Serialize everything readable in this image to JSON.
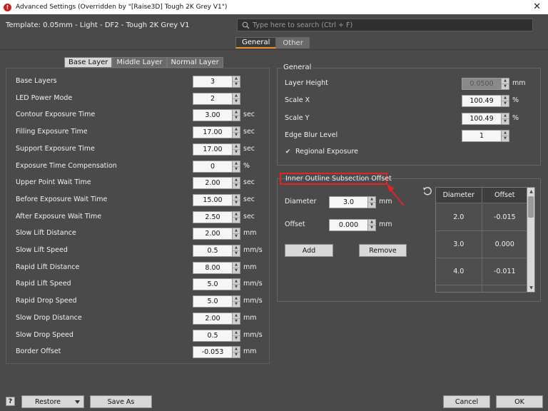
{
  "window": {
    "title": "Advanced Settings (Overridden by \"[Raise3D] Tough 2K Grey V1\")",
    "app_icon_glyph": "!",
    "close_glyph": "✕"
  },
  "template": {
    "label": "Template: 0.05mm - Light - DF2 - Tough 2K Grey V1"
  },
  "search": {
    "placeholder": "Type here to search (Ctrl + F)"
  },
  "top_tabs": [
    {
      "label": "General",
      "active": true
    },
    {
      "label": "Other",
      "active": false
    }
  ],
  "layer_tabs": [
    {
      "label": "Base Layer",
      "active": true
    },
    {
      "label": "Middle Layer",
      "active": false
    },
    {
      "label": "Normal Layer",
      "active": false
    }
  ],
  "layer_params": [
    {
      "label": "Base Layers",
      "value": "3",
      "unit": ""
    },
    {
      "label": "LED Power Mode",
      "value": "2",
      "unit": ""
    },
    {
      "label": "Contour Exposure Time",
      "value": "3.00",
      "unit": "sec"
    },
    {
      "label": "Filling Exposure Time",
      "value": "17.00",
      "unit": "sec"
    },
    {
      "label": "Support Exposure Time",
      "value": "17.00",
      "unit": "sec"
    },
    {
      "label": "Exposure Time Compensation",
      "value": "0",
      "unit": "%"
    },
    {
      "label": "Upper Point Wait Time",
      "value": "2.00",
      "unit": "sec"
    },
    {
      "label": "Before Exposure Wait Time",
      "value": "15.00",
      "unit": "sec"
    },
    {
      "label": "After Exposure Wait Time",
      "value": "2.50",
      "unit": "sec"
    },
    {
      "label": "Slow Lift Distance",
      "value": "2.00",
      "unit": "mm"
    },
    {
      "label": "Slow Lift Speed",
      "value": "0.5",
      "unit": "mm/s"
    },
    {
      "label": "Rapid Lift Distance",
      "value": "8.00",
      "unit": "mm"
    },
    {
      "label": "Rapid Lift Speed",
      "value": "5.0",
      "unit": "mm/s"
    },
    {
      "label": "Rapid Drop Speed",
      "value": "5.0",
      "unit": "mm/s"
    },
    {
      "label": "Slow Drop Distance",
      "value": "2.00",
      "unit": "mm"
    },
    {
      "label": "Slow Drop Speed",
      "value": "0.5",
      "unit": "mm/s"
    },
    {
      "label": "Border Offset",
      "value": "-0.053",
      "unit": "mm"
    }
  ],
  "general": {
    "title": "General",
    "params": [
      {
        "label": "Layer Height",
        "value": "0.0500",
        "unit": "mm",
        "disabled": true
      },
      {
        "label": "Scale X",
        "value": "100.49",
        "unit": "%",
        "disabled": false
      },
      {
        "label": "Scale Y",
        "value": "100.49",
        "unit": "%",
        "disabled": false
      },
      {
        "label": "Edge Blur Level",
        "value": "1",
        "unit": "",
        "disabled": false
      }
    ],
    "regional_exposure": {
      "label": "Regional Exposure",
      "checked": true
    }
  },
  "inner_outline": {
    "title": "Inner Outline Subsection Offset",
    "diameter": {
      "label": "Diameter",
      "value": "3.0",
      "unit": "mm"
    },
    "offset": {
      "label": "Offset",
      "value": "0.000",
      "unit": "mm"
    },
    "add_label": "Add",
    "remove_label": "Remove",
    "table": {
      "columns": [
        "Diameter",
        "Offset"
      ],
      "rows": [
        [
          "2.0",
          "-0.015"
        ],
        [
          "3.0",
          "0.000"
        ],
        [
          "4.0",
          "-0.011"
        ]
      ]
    }
  },
  "footer": {
    "help_label": "?",
    "restore_label": "Restore",
    "save_as_label": "Save As",
    "cancel_label": "Cancel",
    "ok_label": "OK"
  },
  "colors": {
    "background": "#4a4a4a",
    "active_tab_accent": "#e8902a",
    "highlight_annotation": "#e32424"
  }
}
